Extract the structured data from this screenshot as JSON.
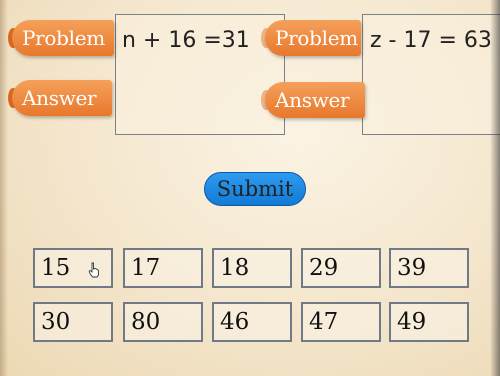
{
  "problems": [
    {
      "problem_label": "Problem",
      "answer_label": "Answer",
      "equation": "n + 16 =31"
    },
    {
      "problem_label": "Problem",
      "answer_label": "Answer",
      "equation": "z - 17 = 63"
    }
  ],
  "submit_label": "Submit",
  "options": [
    "15",
    "17",
    "18",
    "29",
    "39",
    "30",
    "80",
    "46",
    "47",
    "49"
  ],
  "colors": {
    "tab": "#e8782c",
    "submit": "#1f8be6",
    "border": "#6f7a86"
  }
}
